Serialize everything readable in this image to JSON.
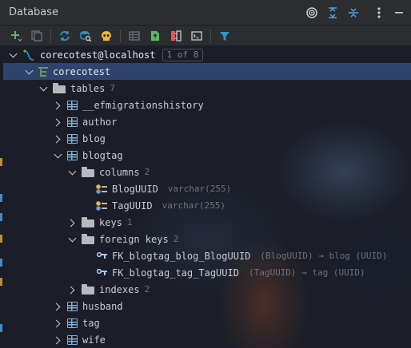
{
  "header": {
    "title": "Database"
  },
  "header_icons": [
    "target-icon",
    "expand-all-icon",
    "collapse-all-icon",
    "more-vertical-icon"
  ],
  "toolbar_icons": [
    "add-icon",
    "copy-icon",
    "refresh-icon",
    "schema-search-icon",
    "skull-icon",
    "table-view-icon",
    "push-icon",
    "diff-icon",
    "console-icon",
    "filter-icon"
  ],
  "tree": {
    "connection": {
      "label": "corecotest@localhost",
      "pager": "1 of 8"
    },
    "schema": {
      "label": "corecotest"
    },
    "tables_folder": {
      "label": "tables",
      "count": "7"
    },
    "tables": [
      {
        "label": "__efmigrationshistory"
      },
      {
        "label": "author"
      },
      {
        "label": "blog"
      },
      {
        "label": "blogtag"
      }
    ],
    "blogtag": {
      "columns": {
        "label": "columns",
        "count": "2",
        "items": [
          {
            "label": "BlogUUID",
            "type": "varchar(255)"
          },
          {
            "label": "TagUUID",
            "type": "varchar(255)"
          }
        ]
      },
      "keys": {
        "label": "keys",
        "count": "1"
      },
      "foreign_keys": {
        "label": "foreign keys",
        "count": "2",
        "items": [
          {
            "label": "FK_blogtag_blog_BlogUUID",
            "hint": "(BlogUUID) → blog (UUID)"
          },
          {
            "label": "FK_blogtag_tag_TagUUID",
            "hint": "(TagUUID) → tag (UUID)"
          }
        ]
      },
      "indexes": {
        "label": "indexes",
        "count": "2"
      }
    },
    "tables_after": [
      {
        "label": "husband"
      },
      {
        "label": "tag"
      },
      {
        "label": "wife"
      }
    ]
  },
  "colors": {
    "selection": "#2e436e",
    "toolbar_bg": "#2b2d30",
    "accent_blue": "#3592c4",
    "accent_green": "#5fb865",
    "accent_yellow": "#e7b93a"
  }
}
